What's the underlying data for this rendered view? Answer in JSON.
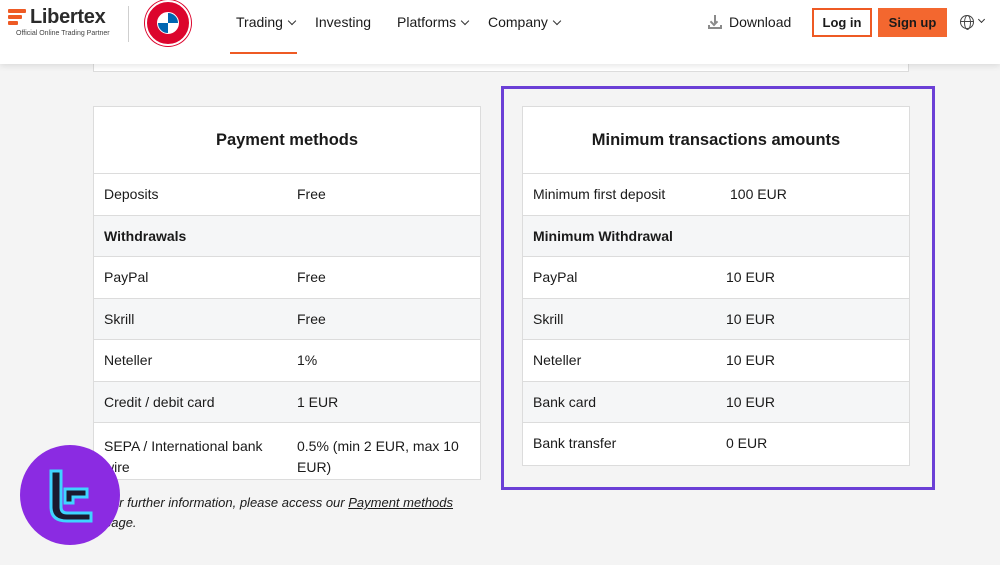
{
  "brand": {
    "name": "Libertex",
    "tagline": "Official Online Trading Partner",
    "accent": "#ee5a24",
    "partner_badge": "fc-bayern-munchen-badge"
  },
  "nav": {
    "items": [
      {
        "label": "Trading",
        "has_dropdown": true,
        "active": true
      },
      {
        "label": "Investing",
        "has_dropdown": false
      },
      {
        "label": "Platforms",
        "has_dropdown": true
      },
      {
        "label": "Company",
        "has_dropdown": true
      }
    ],
    "download_label": "Download",
    "login_label": "Log in",
    "signup_label": "Sign up",
    "language_icon": "globe-icon"
  },
  "payment_methods": {
    "title": "Payment methods",
    "rows": [
      {
        "name": "Deposits",
        "value": "Free"
      },
      {
        "name": "Withdrawals",
        "value": "",
        "section": true
      },
      {
        "name": "PayPal",
        "value": "Free"
      },
      {
        "name": "Skrill",
        "value": "Free"
      },
      {
        "name": "Neteller",
        "value": "1%"
      },
      {
        "name": "Credit / debit card",
        "value": "1 EUR"
      },
      {
        "name": "SEPA / International bank wire",
        "value": "0.5% (min 2 EUR, max 10 EUR)"
      }
    ]
  },
  "minimum_amounts": {
    "title": "Minimum transactions amounts",
    "rows": [
      {
        "name": "Minimum first deposit",
        "value": "100 EUR"
      },
      {
        "name": "Minimum Withdrawal",
        "value": "",
        "section": true
      },
      {
        "name": "PayPal",
        "value": "10 EUR"
      },
      {
        "name": "Skrill",
        "value": "10 EUR"
      },
      {
        "name": "Neteller",
        "value": "10 EUR"
      },
      {
        "name": "Bank card",
        "value": "10 EUR"
      },
      {
        "name": "Bank transfer",
        "value": "0 EUR"
      }
    ],
    "highlight_color": "#6b3fd6"
  },
  "footnote": {
    "prefix": "For further information, please access our ",
    "link": "Payment methods",
    "suffix": " page."
  },
  "watermark": {
    "color": "#8b2be2",
    "icon": "tradingfinder-logo-icon"
  }
}
